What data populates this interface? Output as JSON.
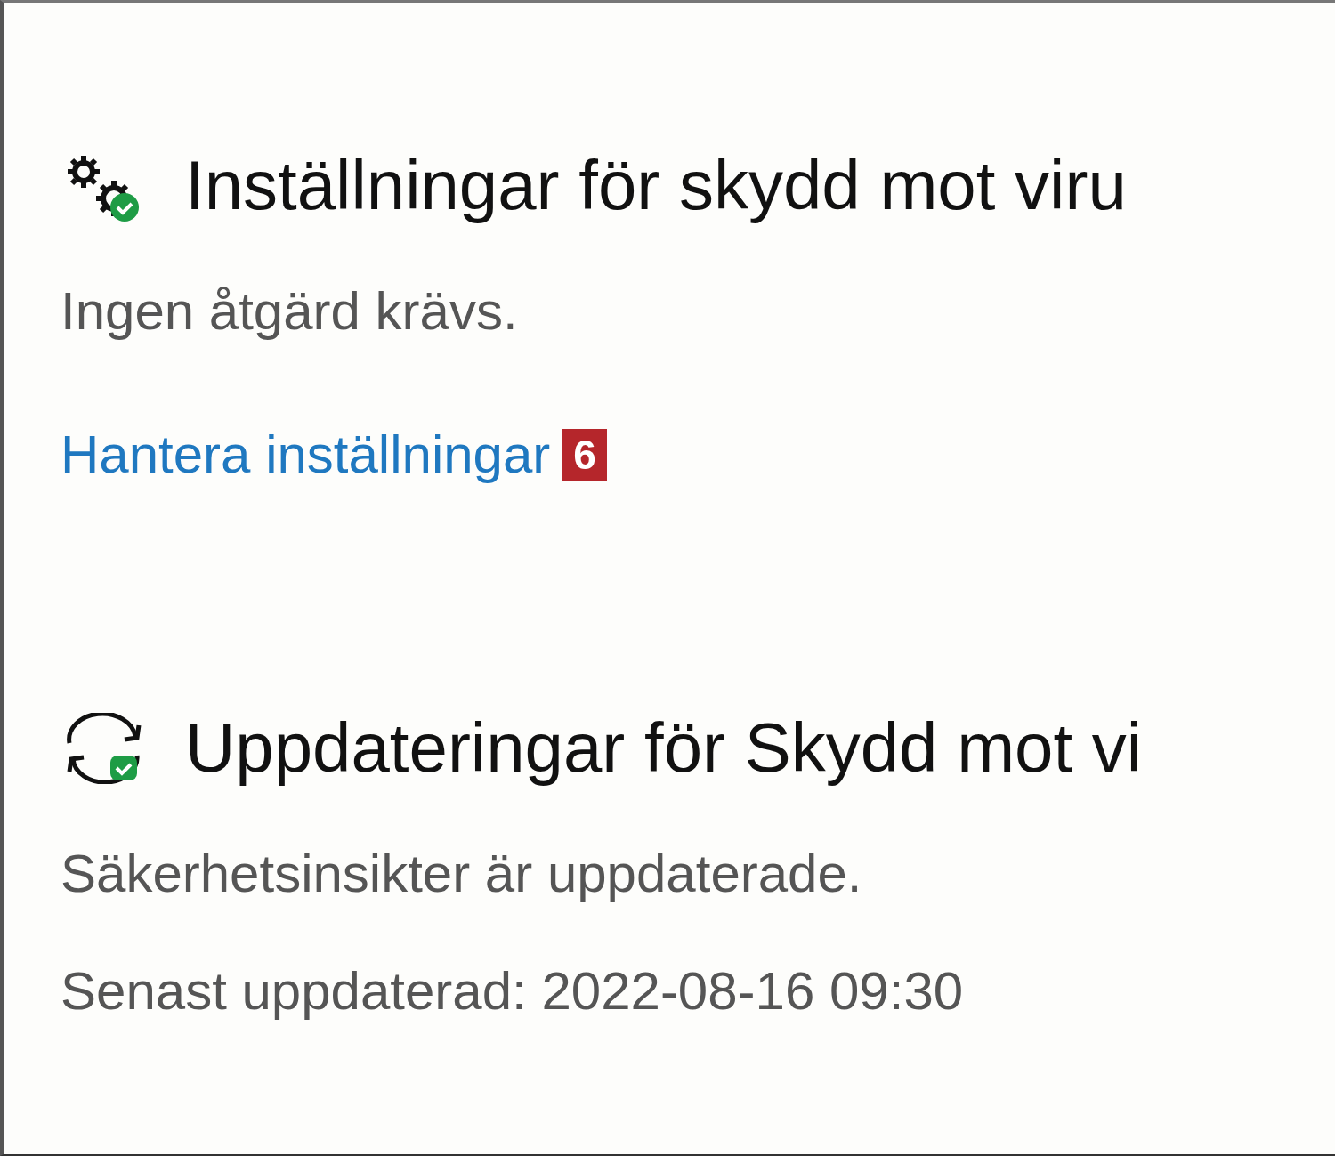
{
  "sections": [
    {
      "kind": "settings",
      "ok": true,
      "title": "Inställningar för skydd mot viru",
      "lines": [
        "Ingen åtgärd krävs."
      ],
      "link": {
        "label": "Hantera inställningar",
        "badge": "6"
      }
    },
    {
      "kind": "update",
      "ok": true,
      "title": "Uppdateringar för Skydd mot vi",
      "lines": [
        "Säkerhetsinsikter är uppdaterade.",
        "Senast uppdaterad: 2022-08-16 09:30"
      ]
    }
  ]
}
